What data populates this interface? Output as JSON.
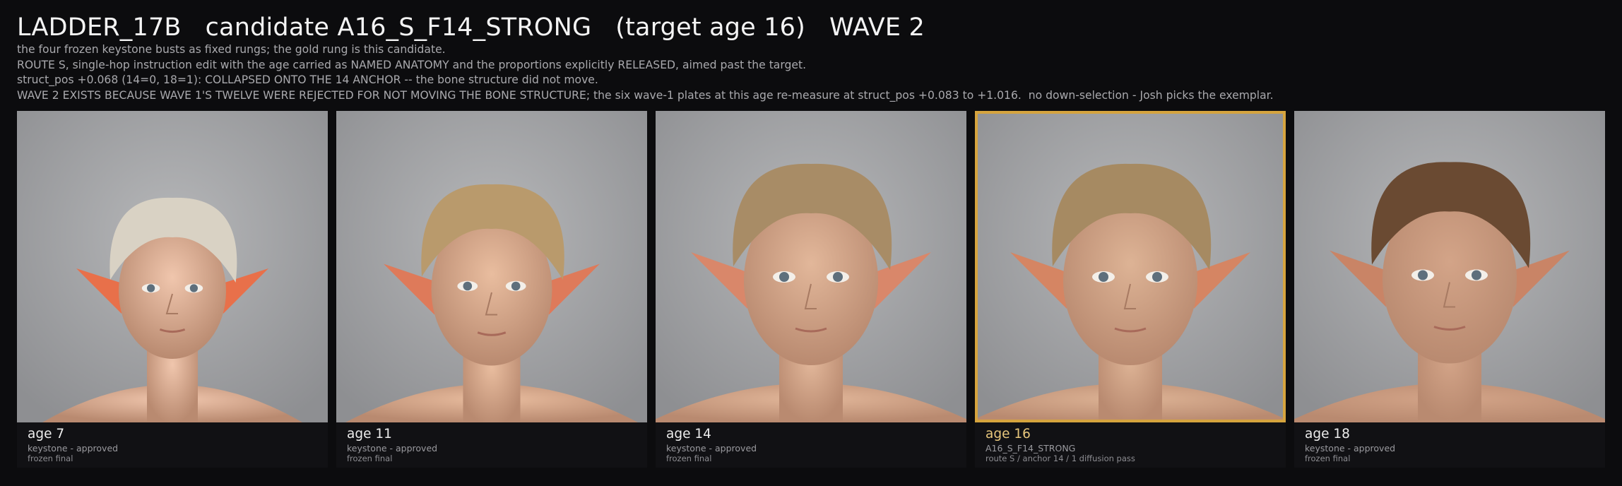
{
  "header": {
    "title": "LADDER_17B   candidate A16_S_F14_STRONG   (target age 16)   WAVE 2",
    "lines": [
      "the four frozen keystone busts as fixed rungs; the gold rung is this candidate.",
      "ROUTE S, single-hop instruction edit with the age carried as NAMED ANATOMY and the proportions explicitly RELEASED, aimed past the target.",
      "struct_pos +0.068 (14=0, 18=1): COLLAPSED ONTO THE 14 ANCHOR -- the bone structure did not move.",
      "WAVE 2 EXISTS BECAUSE WAVE 1'S TWELVE WERE REJECTED FOR NOT MOVING THE BONE STRUCTURE; the six wave-1 plates at this age re-measure at struct_pos +0.083 to +1.016.  no down-selection - Josh picks the exemplar."
    ]
  },
  "colors": {
    "gold_accent": "#d6a43e",
    "background": "#0c0c0e",
    "plate_bg": "#a3a4a6"
  },
  "rungs": [
    {
      "age": "age 7",
      "line1": "keystone - approved",
      "line2": "frozen final",
      "highlight": false,
      "hair": "#d9d2c4",
      "skin": "#f0c6ad",
      "ear": "#e8704a"
    },
    {
      "age": "age 11",
      "line1": "keystone - approved",
      "line2": "frozen final",
      "highlight": false,
      "hair": "#b99a6c",
      "skin": "#e9bd9f",
      "ear": "#de7a5a"
    },
    {
      "age": "age 14",
      "line1": "keystone - approved",
      "line2": "frozen final",
      "highlight": false,
      "hair": "#a88c66",
      "skin": "#e2b79a",
      "ear": "#d9876a"
    },
    {
      "age": "age 16",
      "line1": "A16_S_F14_STRONG",
      "line2": "route S / anchor 14 / 1 diffusion pass",
      "highlight": true,
      "hair": "#a68a62",
      "skin": "#ddb395",
      "ear": "#d58563"
    },
    {
      "age": "age 18",
      "line1": "keystone - approved",
      "line2": "frozen final",
      "highlight": false,
      "hair": "#6a4a32",
      "skin": "#d3a488",
      "ear": "#c98466"
    }
  ]
}
